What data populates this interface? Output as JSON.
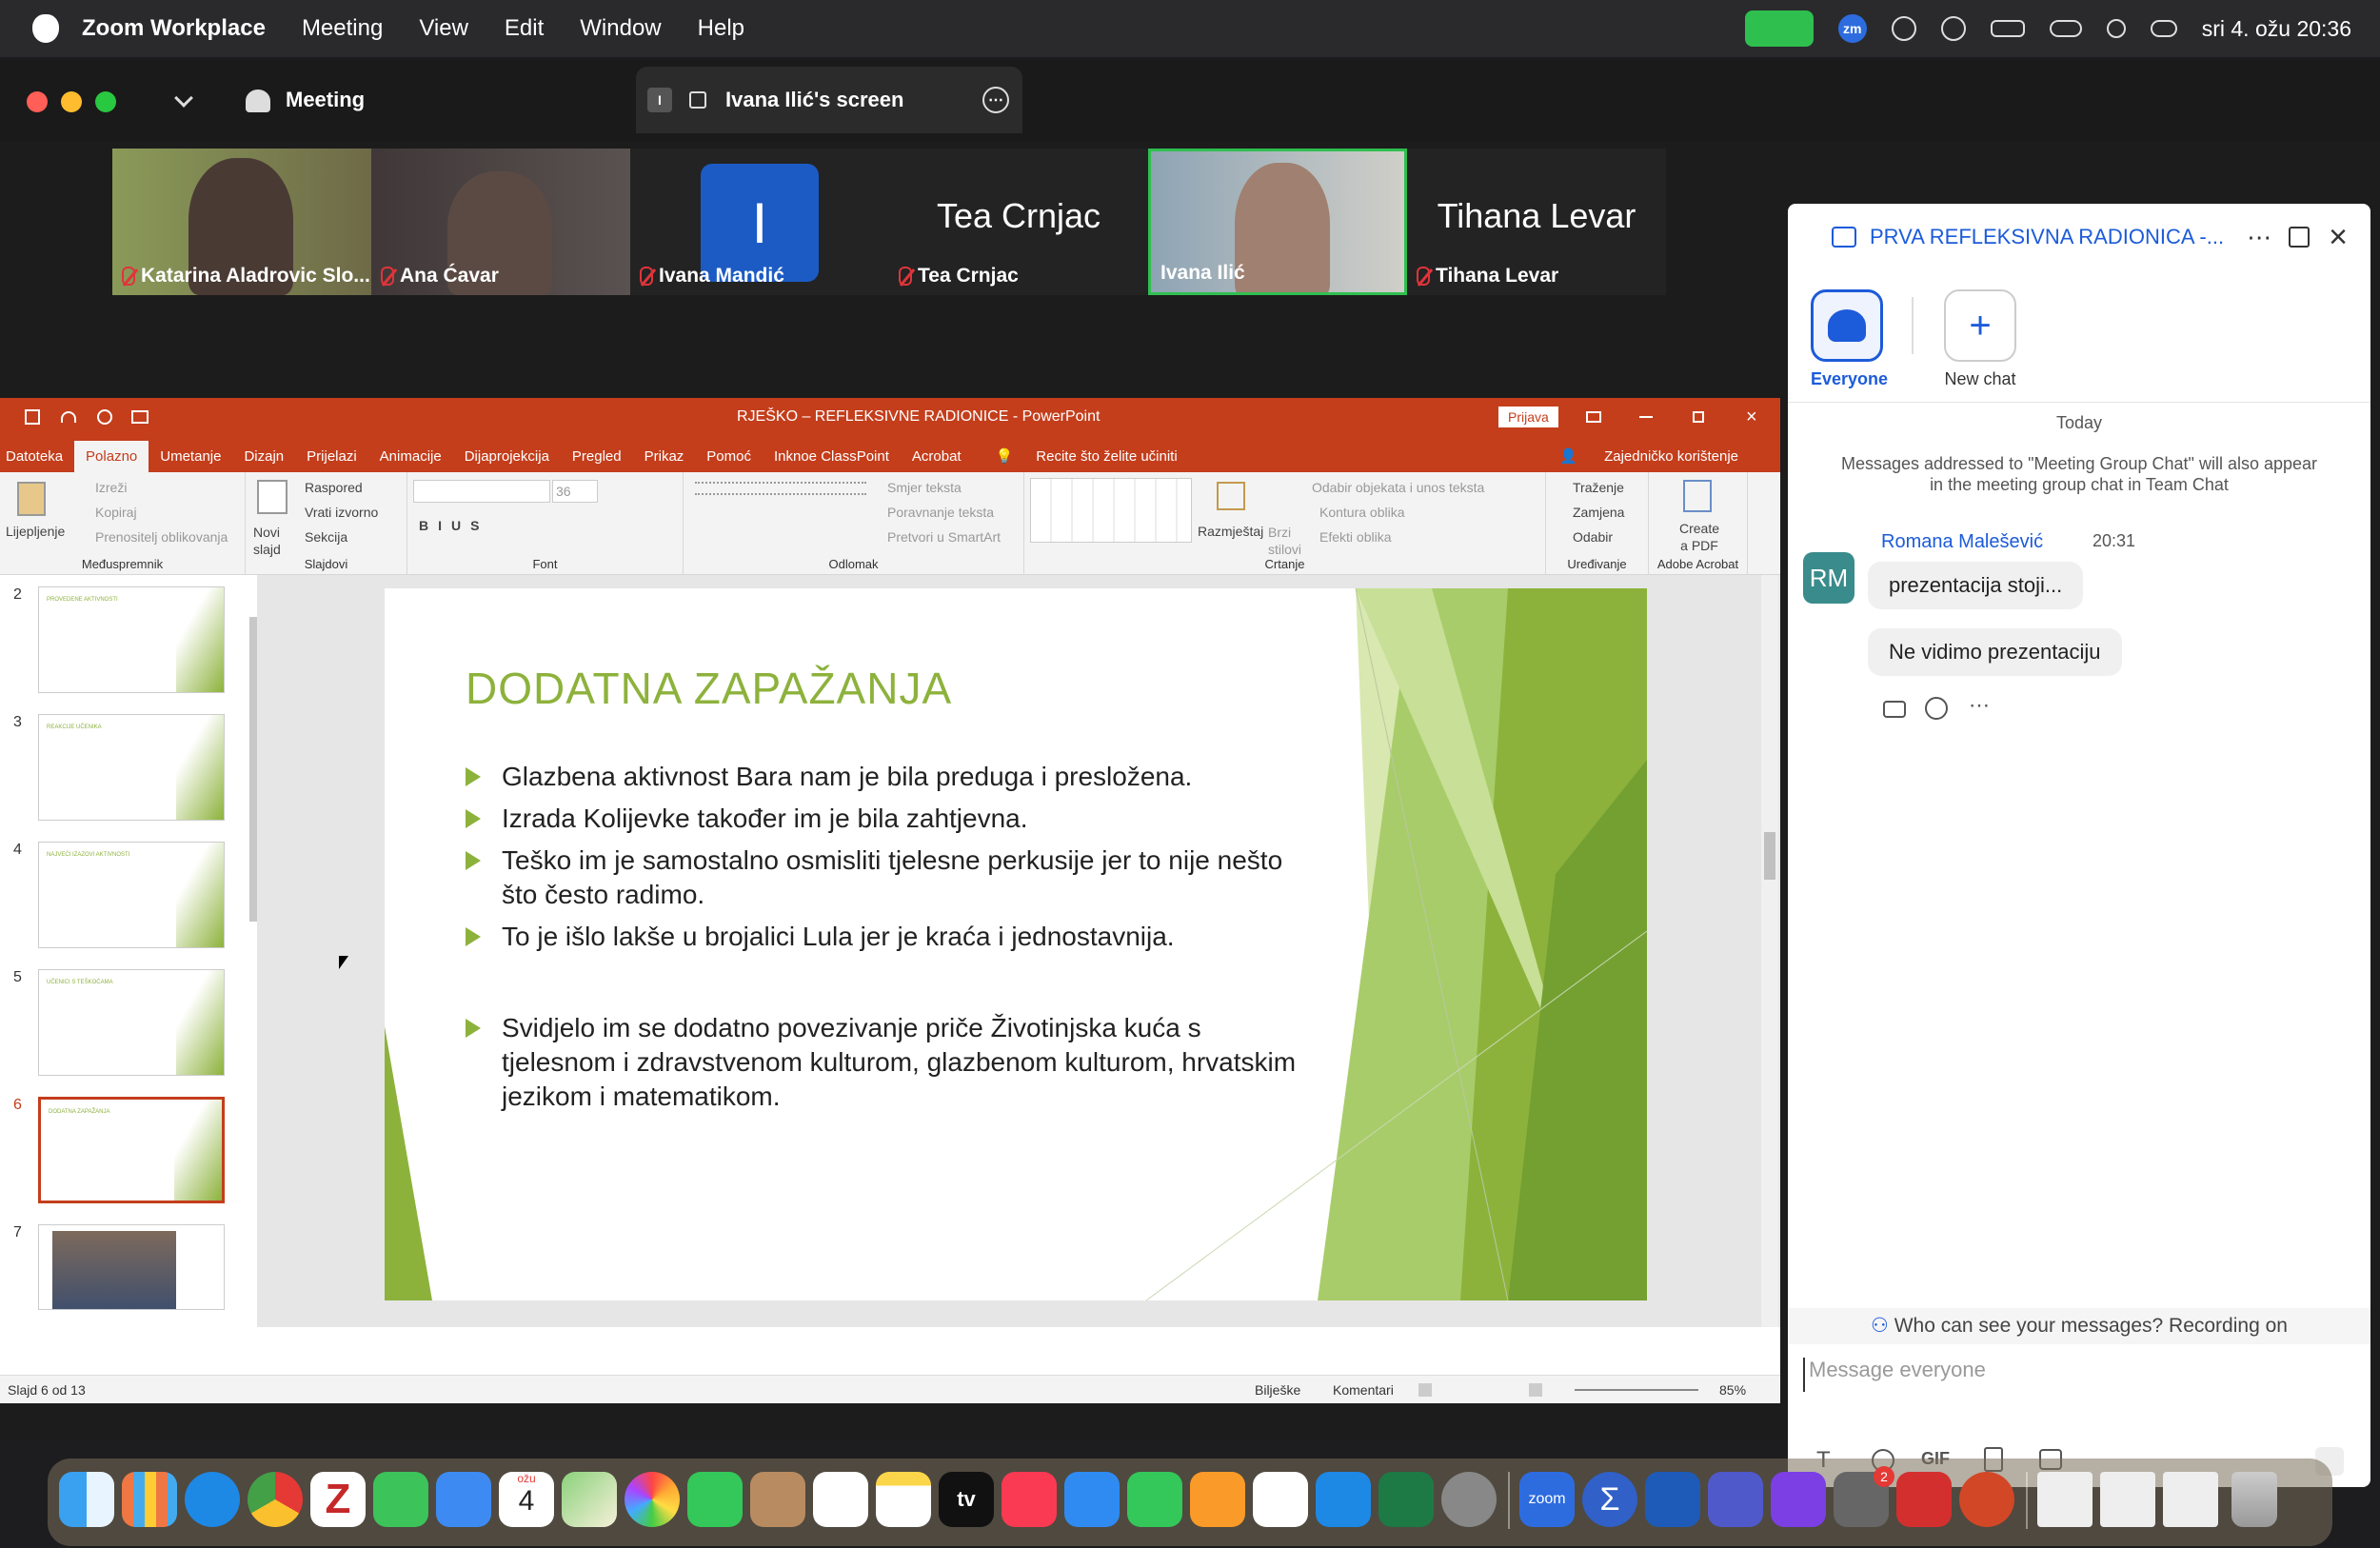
{
  "menubar": {
    "app": "Zoom Workplace",
    "items": [
      "Meeting",
      "View",
      "Edit",
      "Window",
      "Help"
    ],
    "datetime": "sri 4. ožu 20:36"
  },
  "zoom": {
    "meeting_label": "Meeting",
    "screen_share": "Ivana Ilić's screen",
    "screen_badge": "I",
    "participants": [
      {
        "name": "Katarina Aladrovic Slo...",
        "muted": true
      },
      {
        "name": "Ana Ćavar",
        "muted": true
      },
      {
        "name": "Ivana Mandić",
        "initial": "I",
        "muted": true
      },
      {
        "name": "Tea Crnjac",
        "big": "Tea Crnjac",
        "muted": true
      },
      {
        "name": "Ivana Ilić",
        "muted": false,
        "active": true
      },
      {
        "name": "Tihana Levar",
        "big": "Tihana Levar",
        "muted": true
      }
    ]
  },
  "ppt": {
    "title": "RJEŠKO – REFLEKSIVNE RADIONICE  -  PowerPoint",
    "signin": "Prijava",
    "tabs": [
      "Datoteka",
      "Polazno",
      "Umetanje",
      "Dizajn",
      "Prijelazi",
      "Animacije",
      "Dijaprojekcija",
      "Pregled",
      "Prikaz",
      "Pomoć",
      "Inknoe ClassPoint",
      "Acrobat",
      "Recite što želite učiniti"
    ],
    "share": "Zajedničko korištenje",
    "ribbon": {
      "paste": "Lijepljenje",
      "cut": "Izreži",
      "copy": "Kopiraj",
      "format_painter": "Prenositelj oblikovanja",
      "clipboard": "Međuspremnik",
      "new_slide": "Novi slajd",
      "layout": "Raspored",
      "reset": "Vrati izvorno",
      "section": "Sekcija",
      "slides": "Slajdovi",
      "font_size": "36",
      "font": "Font",
      "text_dir": "Smjer teksta",
      "align_text": "Poravnanje teksta",
      "smartart": "Pretvori u SmartArt",
      "paragraph": "Odlomak",
      "arrange": "Razmještaj",
      "quick_styles": "Brzi stilovi",
      "select_obj": "Odabir objekata i unos teksta",
      "outline": "Kontura oblika",
      "effects": "Efekti oblika",
      "drawing": "Crtanje",
      "find": "Traženje",
      "replace": "Zamjena",
      "select": "Odabir",
      "editing": "Uređivanje",
      "create_pdf": "Create a PDF",
      "acrobat": "Adobe Acrobat"
    },
    "thumb_numbers": [
      "2",
      "3",
      "4",
      "5",
      "6",
      "7"
    ],
    "thumb_titles": [
      "PROVEDENE AKTIVNOSTI",
      "REAKCIJE UČENIKA",
      "NAJVEĆI IZAZOVI AKTIVNOSTI",
      "UČENICI S TEŠKOĆAMA",
      "DODATNA ZAPAŽANJA",
      ""
    ],
    "slide": {
      "title": "DODATNA ZAPAŽANJA",
      "bullets": [
        "Glazbena aktivnost Bara nam je bila preduga i presložena.",
        "Izrada Kolijevke također im je bila zahtjevna.",
        "Teško im je samostalno osmisliti tjelesne perkusije jer to nije nešto što često radimo.",
        "To je išlo lakše u brojalici Lula  jer je kraća i jednostavnija.",
        "Svidjelo im se dodatno povezivanje priče Životinjska kuća s tjelesnom i zdravstvenom kulturom, glazbenom kulturom, hrvatskim jezikom i matematikom."
      ]
    },
    "status": {
      "slide": "Slajd 6 od 13",
      "notes": "Bilješke",
      "comments": "Komentari",
      "zoom": "85%"
    }
  },
  "chat": {
    "title": "PRVA REFLEKSIVNA RADIONICA -...",
    "everyone": "Everyone",
    "new_chat": "New chat",
    "day": "Today",
    "notice": "Messages addressed to \"Meeting Group Chat\" will also appear in the meeting group chat in Team Chat",
    "sender": "Romana Malešević",
    "time": "20:31",
    "avatar": "RM",
    "messages": [
      "prezentacija stoji...",
      "Ne vidimo prezentaciju"
    ],
    "privacy": "Who can see your messages? Recording on",
    "placeholder": "Message everyone",
    "gif": "GIF"
  },
  "dock": {
    "calendar_month": "ožu",
    "calendar_day": "4",
    "tv": "tv",
    "zoom": "zoom",
    "badge": "2"
  }
}
